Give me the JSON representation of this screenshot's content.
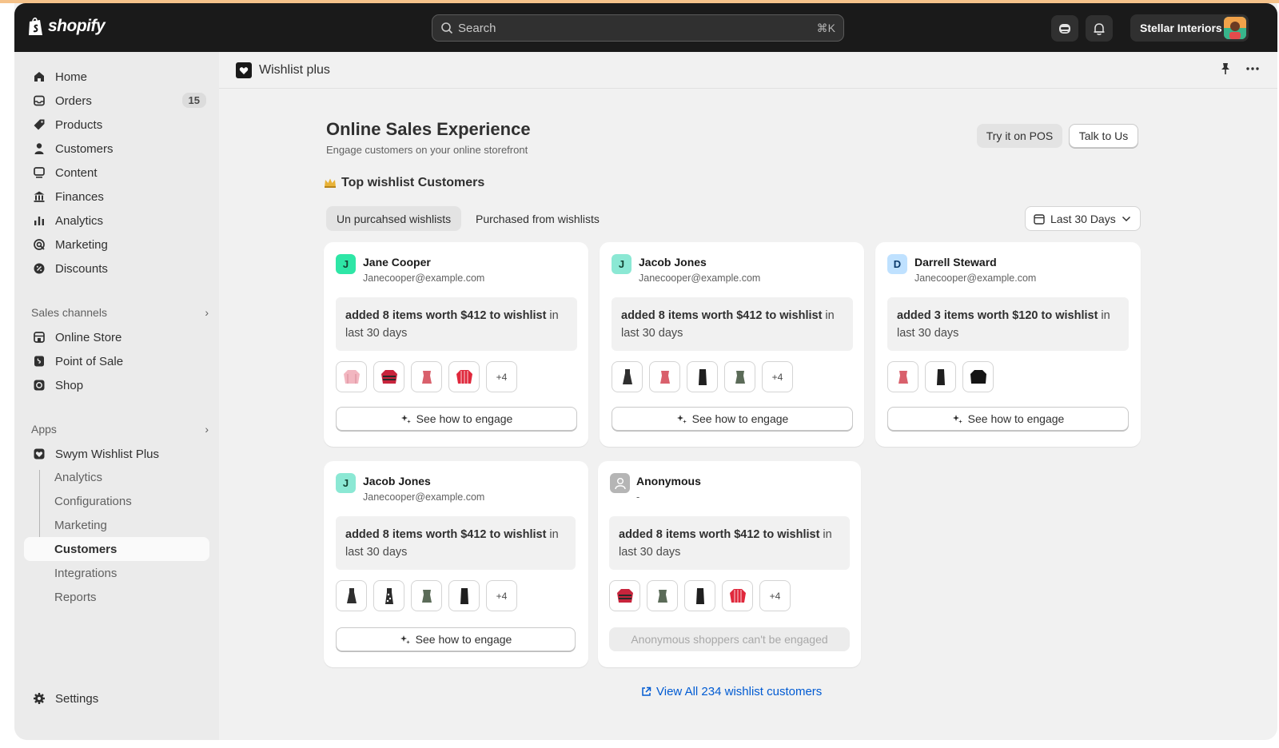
{
  "brand": {
    "name": "shopify"
  },
  "search": {
    "placeholder": "Search",
    "shortcut": "⌘K"
  },
  "store": {
    "name": "Stellar Interiors"
  },
  "nav": {
    "home": "Home",
    "orders": "Orders",
    "orders_badge": "15",
    "products": "Products",
    "customers": "Customers",
    "content": "Content",
    "finances": "Finances",
    "analytics": "Analytics",
    "marketing": "Marketing",
    "discounts": "Discounts",
    "sales_channels": "Sales channels",
    "online_store": "Online Store",
    "pos": "Point of Sale",
    "shop": "Shop",
    "apps": "Apps",
    "swym": "Swym Wishlist Plus",
    "sub_analytics": "Analytics",
    "sub_config": "Configurations",
    "sub_marketing": "Marketing",
    "sub_customers": "Customers",
    "sub_integrations": "Integrations",
    "sub_reports": "Reports",
    "settings": "Settings"
  },
  "app": {
    "name": "Wishlist plus"
  },
  "page": {
    "title": "Online Sales Experience",
    "subtitle": "Engage customers on your online storefront",
    "btn_pos": "Try it on POS",
    "btn_talk": "Talk to Us",
    "section_title": "Top wishlist Customers",
    "tab_unpurchased": "Un purcahsed wishlists",
    "tab_purchased": "Purchased from wishlists",
    "date_range": "Last 30 Days",
    "view_all": "View All 234 wishlist customers"
  },
  "cards": [
    {
      "initial": "J",
      "name": "Jane Cooper",
      "email": "Janecooper@example.com",
      "summary_bold": "added 8 items worth $412 to wishlist",
      "summary_rest": " in last 30 days",
      "more": "+4",
      "action": "See how to engage"
    },
    {
      "initial": "J",
      "name": "Jacob Jones",
      "email": "Janecooper@example.com",
      "summary_bold": "added 8 items worth $412 to wishlist",
      "summary_rest": " in last 30 days",
      "more": "+4",
      "action": "See how to engage"
    },
    {
      "initial": "D",
      "name": "Darrell Steward",
      "email": "Janecooper@example.com",
      "summary_bold": "added 3 items worth $120 to wishlist",
      "summary_rest": " in last 30 days",
      "action": "See how to engage"
    },
    {
      "initial": "J",
      "name": "Jacob Jones",
      "email": "Janecooper@example.com",
      "summary_bold": "added 8 items worth $412 to wishlist",
      "summary_rest": " in last 30 days",
      "more": "+4",
      "action": "See how to engage"
    },
    {
      "name": "Anonymous",
      "email": "-",
      "summary_bold": "added 8 items worth $412 to wishlist",
      "summary_rest": " in last 30 days",
      "more": "+4",
      "action": "Anonymous shoppers can't be engaged"
    }
  ],
  "colors": {
    "avatar_green": "#2ee6a6",
    "avatar_teal": "#8be8d4",
    "avatar_blue": "#bfe1ff",
    "link": "#005bd3"
  }
}
